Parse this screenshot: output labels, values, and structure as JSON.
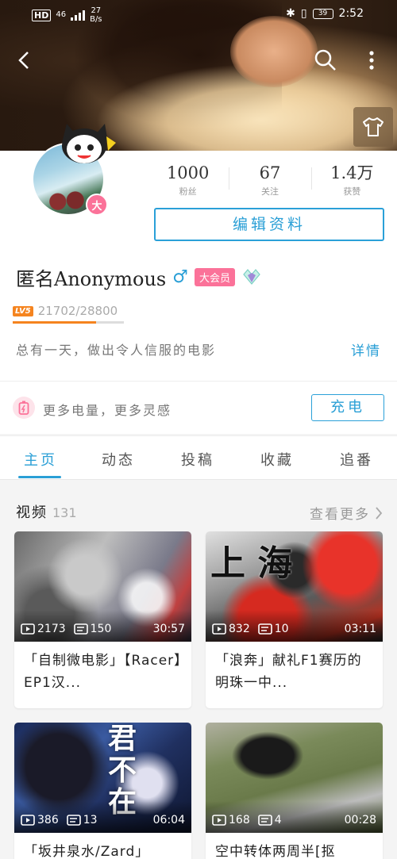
{
  "status_bar": {
    "hd": "HD",
    "network": "46",
    "speed_value": "27",
    "speed_unit": "B/s",
    "battery": "39",
    "time": "2:52"
  },
  "stats": [
    {
      "value": "1000",
      "label": "粉丝"
    },
    {
      "value": "67",
      "label": "关注"
    },
    {
      "value": "1.4万",
      "label": "获赞"
    }
  ],
  "avatar_badge": "大",
  "edit_profile_label": "编辑资料",
  "profile": {
    "name": "匿名Anonymous",
    "gender_symbol": "♂",
    "vip_label": "大会员",
    "level_label": "LV5",
    "exp_text": "21702/28800",
    "exp_progress": 0.7535,
    "signature": "总有一天，做出令人信服的电影",
    "detail_link": "详情"
  },
  "charge": {
    "text": "更多电量，更多灵感",
    "button": "充电"
  },
  "tabs": [
    "主页",
    "动态",
    "投稿",
    "收藏",
    "追番"
  ],
  "active_tab": 0,
  "videos_section": {
    "title": "视频",
    "count": "131",
    "more_label": "查看更多"
  },
  "videos": [
    {
      "plays": "2173",
      "danmaku": "150",
      "duration": "30:57",
      "title": "「自制微电影」【Racer】EP1汉..."
    },
    {
      "plays": "832",
      "danmaku": "10",
      "duration": "03:11",
      "title": "「浪奔」献礼F1赛历的明珠一中...",
      "overlay": "上 海"
    },
    {
      "plays": "386",
      "danmaku": "13",
      "duration": "06:04",
      "title": "「坂井泉水/Zard」",
      "overlay": "君 不 在"
    },
    {
      "plays": "168",
      "danmaku": "4",
      "duration": "00:28",
      "title": "空中转体两周半[抠"
    }
  ],
  "colors": {
    "accent": "#2a9fd6",
    "pink": "#fb7299",
    "level_orange": "#f5841f"
  }
}
